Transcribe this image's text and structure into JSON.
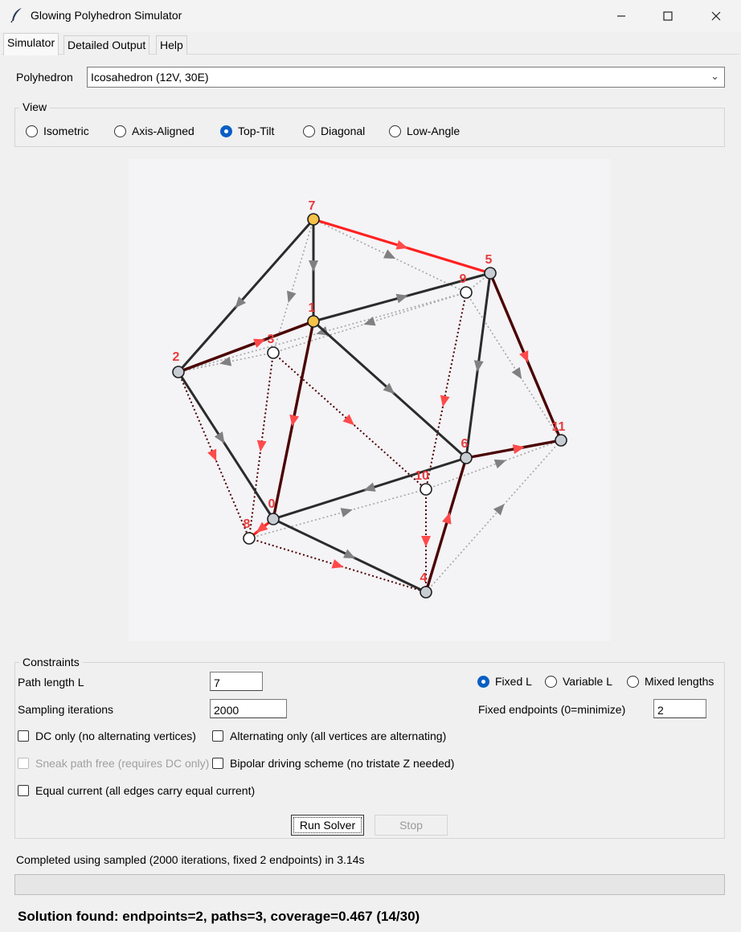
{
  "window": {
    "title": "Glowing Polyhedron Simulator",
    "icon": "feather-icon",
    "controls": [
      "minimize-icon",
      "maximize-icon",
      "close-icon"
    ]
  },
  "tabs": [
    {
      "label": "Simulator",
      "active": true
    },
    {
      "label": "Detailed Output",
      "active": false
    },
    {
      "label": "Help",
      "active": false
    }
  ],
  "polyhedron": {
    "label": "Polyhedron",
    "selected": "Icosahedron (12V, 30E)"
  },
  "view": {
    "title": "View",
    "options": [
      "Isometric",
      "Axis-Aligned",
      "Top-Tilt",
      "Diagonal",
      "Low-Angle"
    ],
    "selected": "Top-Tilt"
  },
  "canvas": {
    "vertex_labels": [
      "0",
      "1",
      "2",
      "3",
      "4",
      "5",
      "6",
      "7",
      "8",
      "9",
      "10",
      "11"
    ],
    "colors": {
      "background": "#f4f3f6",
      "active_edge": "#4a0000",
      "bright_edge": "#ff2020",
      "structural_edge": "#2b2b2b",
      "hidden_edge": "#a5a5a5",
      "arrow_red": "#ff4a4a",
      "arrow_gray": "#808080",
      "endpoint_fill": "#f5c24a",
      "vertex_fill": "#c8cdd3",
      "label": "#e83c3c"
    }
  },
  "constraints": {
    "title": "Constraints",
    "path_length_label": "Path length L",
    "path_length_value": "7",
    "sampling_label": "Sampling iterations",
    "sampling_value": "2000",
    "length_modes": [
      "Fixed L",
      "Variable L",
      "Mixed lengths"
    ],
    "length_mode_selected": "Fixed L",
    "fixed_endpoints_label": "Fixed endpoints (0=minimize)",
    "fixed_endpoints_value": "2",
    "dc_only": "DC only (no alternating vertices)",
    "alternating_only": "Alternating only (all vertices are alternating)",
    "sneak_path": "Sneak path free (requires DC only)",
    "bipolar": "Bipolar driving scheme (no tristate Z needed)",
    "equal_current": "Equal current (all edges carry equal current)"
  },
  "actions": {
    "run": "Run Solver",
    "stop": "Stop"
  },
  "status": {
    "message": "Completed using sampled (2000 iterations, fixed 2 endpoints) in 3.14s",
    "progress": 0,
    "result": "Solution found: endpoints=2, paths=3, coverage=0.467 (14/30)"
  }
}
